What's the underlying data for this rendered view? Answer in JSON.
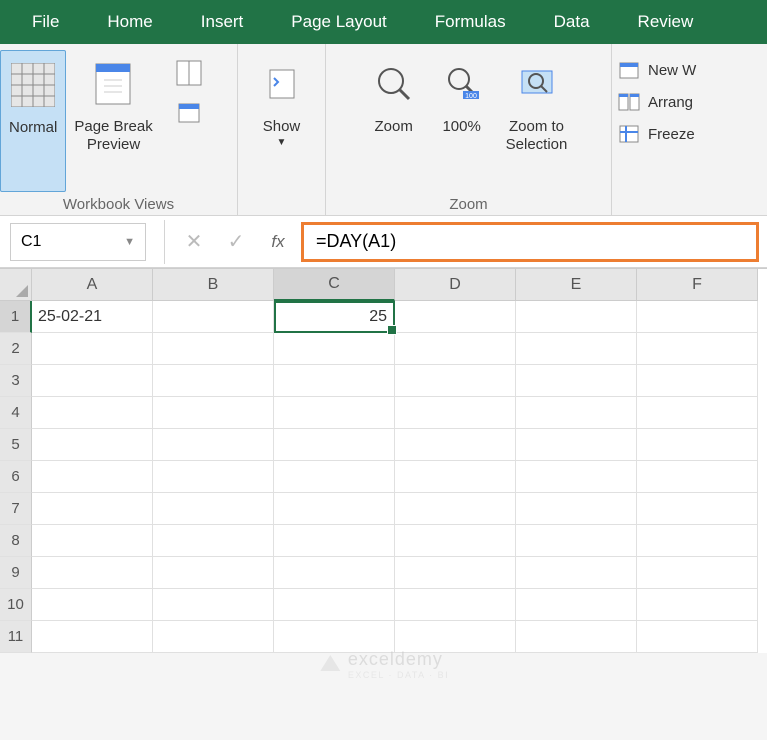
{
  "tabs": [
    "File",
    "Home",
    "Insert",
    "Page Layout",
    "Formulas",
    "Data",
    "Review"
  ],
  "ribbon": {
    "workbook_views": {
      "label": "Workbook Views",
      "normal": "Normal",
      "page_break": "Page Break\nPreview",
      "show": "Show"
    },
    "zoom": {
      "label": "Zoom",
      "zoom": "Zoom",
      "hundred": "100%",
      "zoom_to_selection": "Zoom to\nSelection"
    },
    "window": {
      "new_w": "New W",
      "arrang": "Arrang",
      "freeze": "Freeze"
    }
  },
  "formula_bar": {
    "name_box": "C1",
    "formula": "=DAY(A1)"
  },
  "grid": {
    "columns": [
      "A",
      "B",
      "C",
      "D",
      "E",
      "F"
    ],
    "rows": [
      "1",
      "2",
      "3",
      "4",
      "5",
      "6",
      "7",
      "8",
      "9",
      "10",
      "11"
    ],
    "selected_col": "C",
    "selected_row": "1",
    "cells": {
      "A1": "25-02-21",
      "C1": "25"
    }
  },
  "watermark": {
    "brand": "exceldemy",
    "sub": "EXCEL · DATA · BI"
  }
}
